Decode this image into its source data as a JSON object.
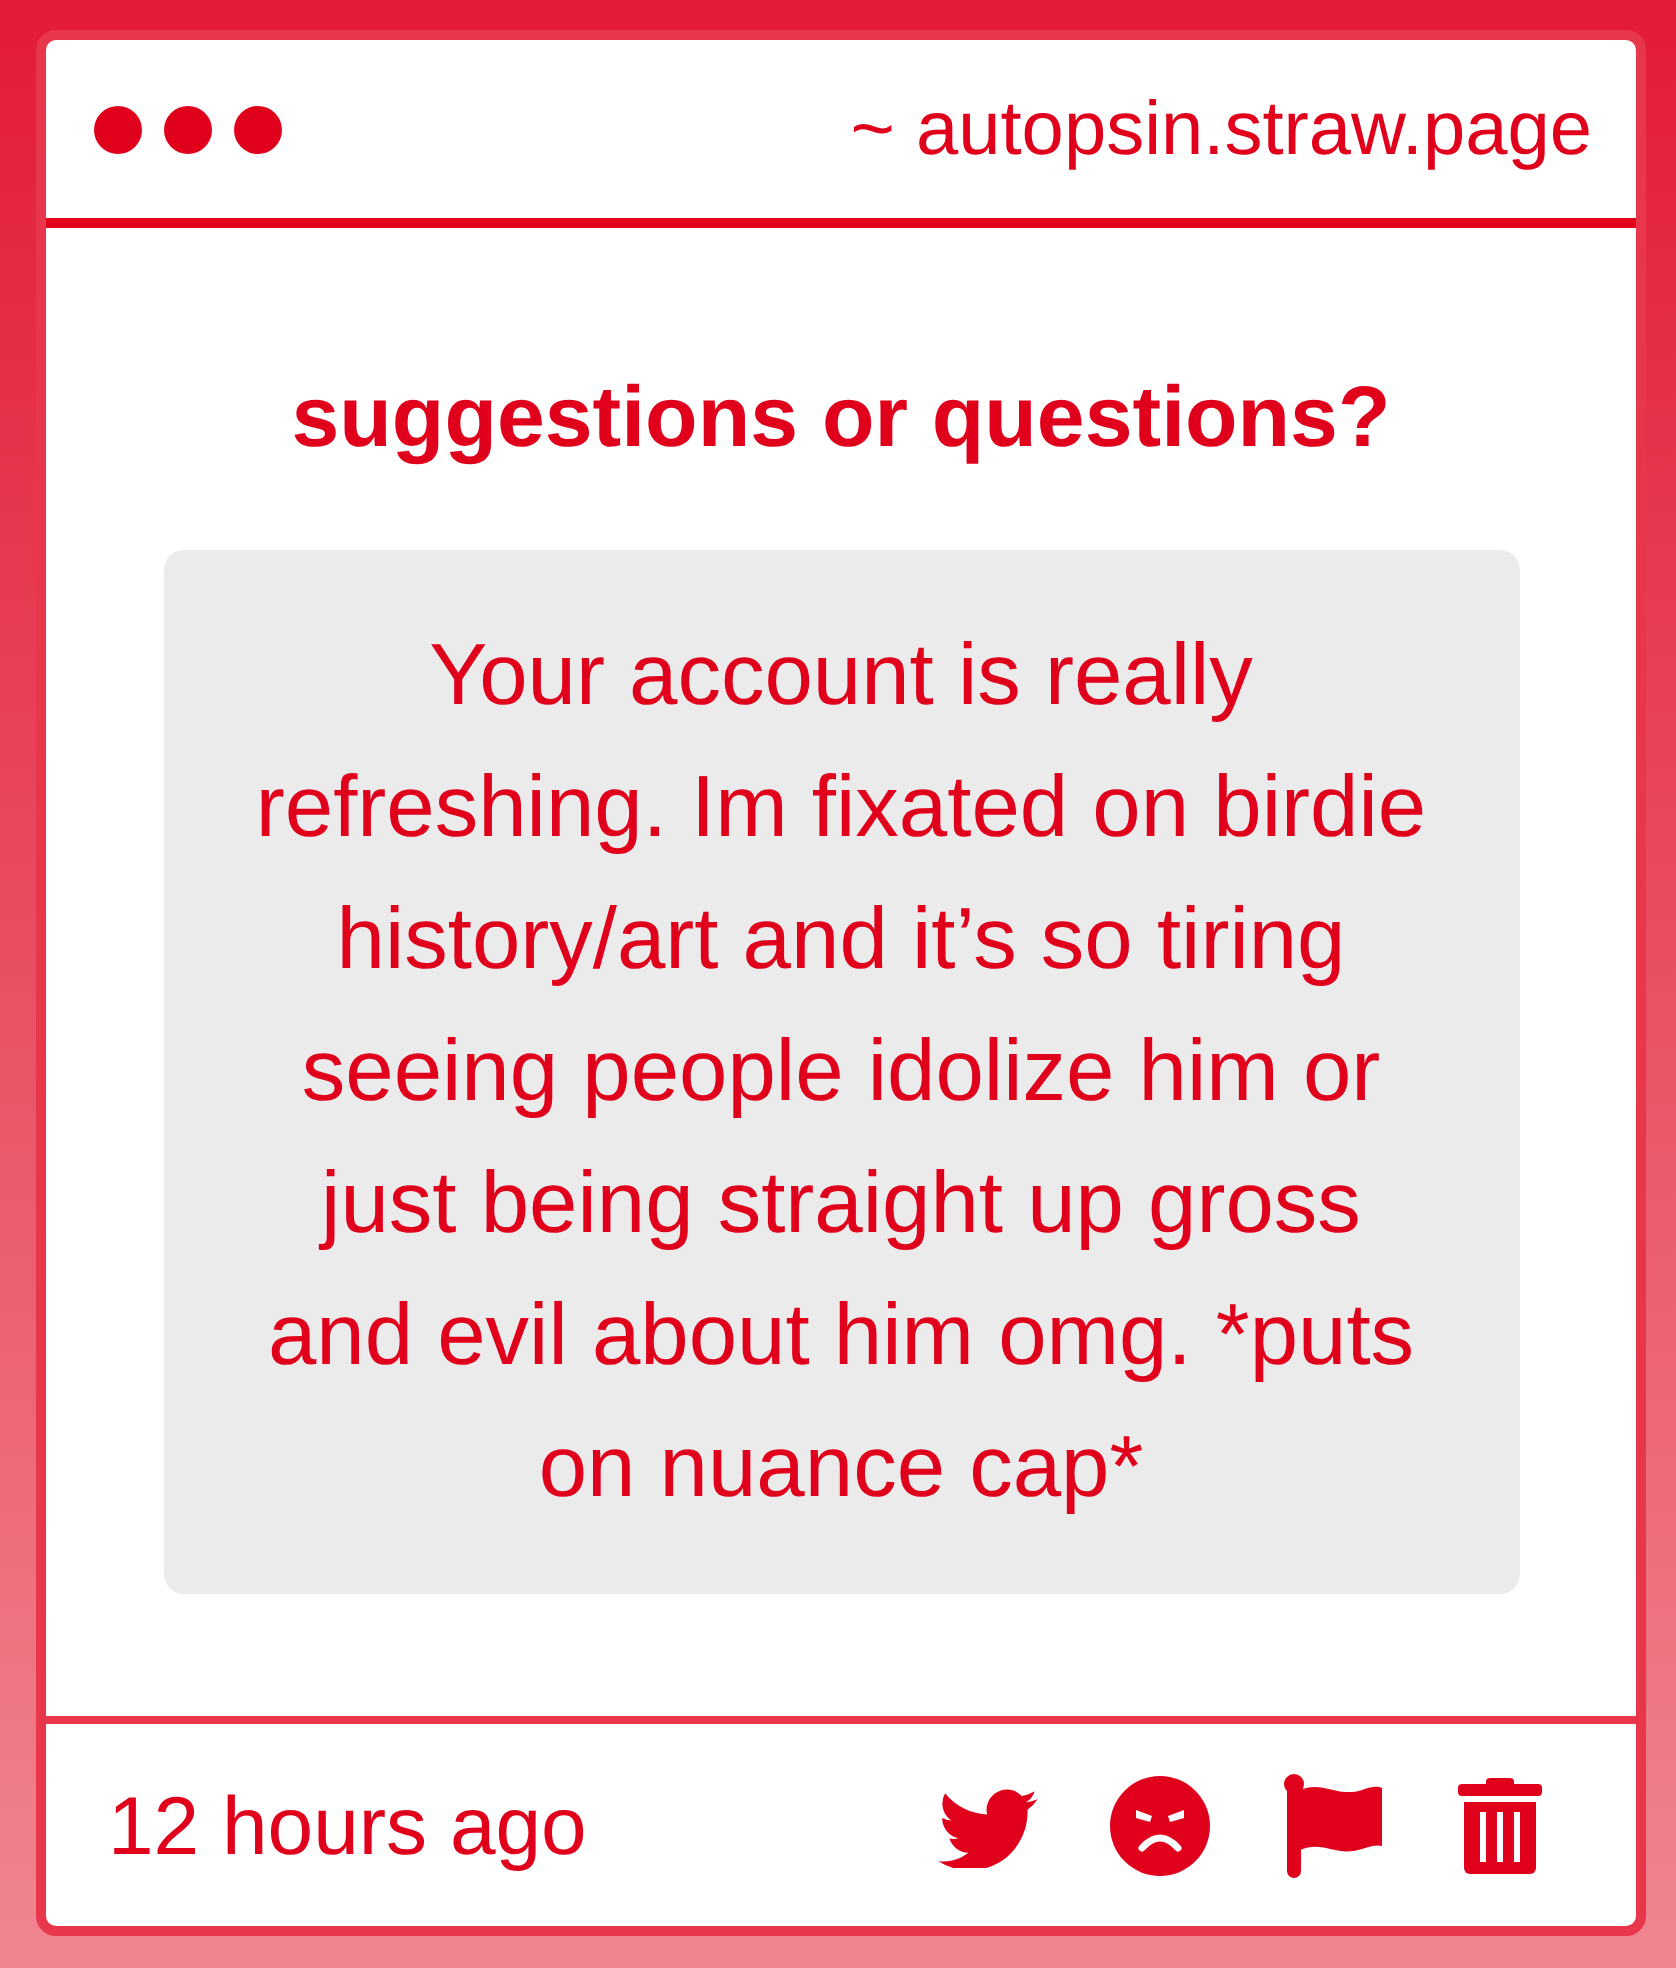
{
  "header": {
    "url": "~ autopsin.straw.page"
  },
  "title": "suggestions or questions?",
  "message": "Your account is really refreshing. Im fixated on birdie history/art and it’s so tiring seeing people idolize him or just being straight up gross and evil about him omg. *puts on nuance cap*",
  "footer": {
    "time": "12 hours ago"
  }
}
